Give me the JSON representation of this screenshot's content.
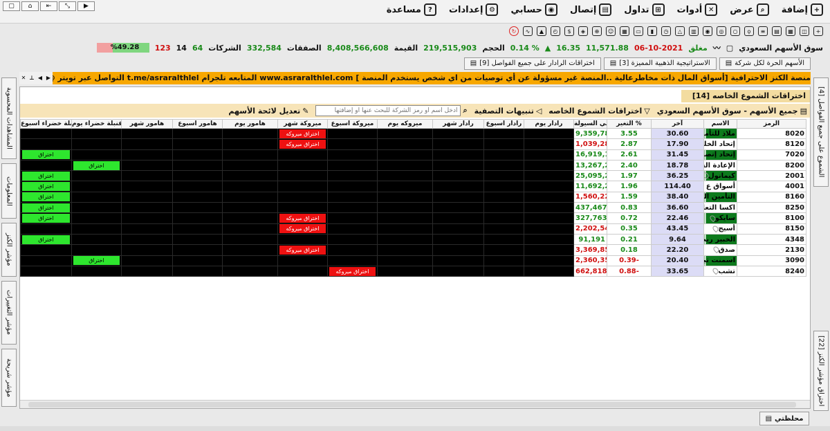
{
  "window": {
    "controls": [
      "▢",
      "⌂",
      "⇤",
      "⤡",
      "▶"
    ]
  },
  "menu": [
    {
      "label": "إضافة",
      "icon": "add-icon",
      "glyph": "+"
    },
    {
      "label": "عرض",
      "icon": "view-icon",
      "glyph": "⌕"
    },
    {
      "label": "أدوات",
      "icon": "tools-icon",
      "glyph": "✕"
    },
    {
      "label": "تداول",
      "icon": "cart-icon",
      "glyph": "⊞"
    },
    {
      "label": "إتصال",
      "icon": "connect-icon",
      "glyph": "▤"
    },
    {
      "label": "حسابي",
      "icon": "user-icon",
      "glyph": "◉"
    },
    {
      "label": "إعدادات",
      "icon": "gear-icon",
      "glyph": "⚙"
    },
    {
      "label": "مساعدة",
      "icon": "help-icon",
      "glyph": "?"
    }
  ],
  "summary": {
    "market": "سوق الأسهم السعودي",
    "status": "مغلق",
    "date": "06-10-2021",
    "index": "11,571.88",
    "change": "16.35",
    "change_pct": "0.14 %",
    "volume_label": "الحجم",
    "volume": "219,515,903",
    "value_label": "القيمة",
    "value": "8,408,566,608",
    "deals_label": "الصفقات",
    "deals": "332,584",
    "companies_label": "الشركات",
    "up": "64",
    "unchanged": "14",
    "down": "123",
    "breadth_pct": "%49.28"
  },
  "tabs": [
    "الأسهم الحرة لكل شركة",
    "الاستراتيجية الذهبية المميزة [3]",
    "اختراقات الرادار على جميع الفواصل [9]"
  ],
  "ticker": "منصة الكنز الاحترافية [أسواق المال ذات مخاطرعالية ..المنصة غير مسؤولة عن أي توصيات من اي شخص يستخدم المنصة ]   www.asraralthlel.com   المتابعه  تلجرام  t.me/asraralthlel التواصل عبر تويتر @aber_sabel3",
  "side_tabs_right": [
    "الشموع على جميع الفواصل [4]",
    "اختراق مؤشر الكنز [22]"
  ],
  "side_tabs_left": [
    "المشاهدات المحسوبة",
    "المعلومات",
    "مؤشر الكنز",
    "مؤشر التغييرات",
    "مؤشر شريحة"
  ],
  "panel": {
    "title": "اختراقات الشموع الخاصه [14]",
    "market_filter": "جميع الأسهم - سوق الأسهم السعودي",
    "filter_label": "اختراقات الشموع الخاصه",
    "alerts_label": "تنبيهات التصفية",
    "search_placeholder": "ادخل اسم أو رمز الشركة للبحث عنها أو إضافتها",
    "edit_list_label": "تعديل لائحة الأسهم"
  },
  "columns": [
    "الرمز",
    "الاسم",
    "آخر",
    "التغير %",
    "صافي السيولة",
    "رادار يوم",
    "رادار اسبوع",
    "رادار شهر",
    "ميروكه يوم",
    "ميروكة اسبوع",
    "ميروكة شهر",
    "هامور يوم",
    "هامور اسبوع",
    "هامور شهر",
    "قنبلة خضراء يوم",
    "قنبلة خضراء اسبوع"
  ],
  "signals": {
    "green": "اختراق",
    "red": "اختراق ميروكه"
  },
  "rows": [
    {
      "symbol": "8020",
      "name": "ملاذ للتأمين",
      "dark": true,
      "last": "30.60",
      "chg": "3.55",
      "chg_neg": false,
      "liq": "9,359,787",
      "liq_neg": false,
      "sig": {
        "5": "r"
      }
    },
    {
      "symbol": "8120",
      "name": "إتحاد الخليج الأهلية",
      "dark": false,
      "last": "17.90",
      "chg": "2.87",
      "chg_neg": false,
      "liq": "1,039,285-",
      "liq_neg": true,
      "sig": {
        "5": "r",
        "11": "g"
      }
    },
    {
      "symbol": "7020",
      "name": "إتحاد إتصالات",
      "dark": true,
      "last": "31.45",
      "chg": "2.61",
      "chg_neg": false,
      "liq": "16,919,159",
      "liq_neg": false,
      "sig": {
        "0": "g",
        "12": "g"
      }
    },
    {
      "symbol": "8200",
      "name": "الإعادة السعودية",
      "dark": false,
      "last": "18.78",
      "chg": "2.40",
      "chg_neg": false,
      "liq": "13,267,288",
      "liq_neg": false,
      "sig": {
        "1": "g",
        "11": "g"
      }
    },
    {
      "symbol": "2001",
      "name": "كيمانول",
      "dark": true,
      "last": "36.25",
      "chg": "1.97",
      "chg_neg": false,
      "liq": "25,095,260",
      "liq_neg": false,
      "sig": {
        "0": "g",
        "12": "g"
      }
    },
    {
      "symbol": "4001",
      "name": "أسواق ع العثيم",
      "dark": false,
      "last": "114.40",
      "chg": "1.96",
      "chg_neg": false,
      "liq": "11,692,289",
      "liq_neg": false,
      "sig": {
        "0": "g",
        "12": "g"
      }
    },
    {
      "symbol": "8160",
      "name": "التأمين العربية",
      "dark": true,
      "last": "38.40",
      "chg": "1.59",
      "chg_neg": false,
      "liq": "1,560,222-",
      "liq_neg": true,
      "sig": {
        "0": "g",
        "11": "g",
        "12": "g"
      }
    },
    {
      "symbol": "8250",
      "name": "اكسا التعاونية",
      "dark": false,
      "last": "36.60",
      "chg": "0.83",
      "chg_neg": false,
      "liq": "437,467",
      "liq_neg": false,
      "sig": {
        "0": "g",
        "11": "g",
        "12": "g"
      }
    },
    {
      "symbol": "8100",
      "name": "سايكو",
      "dark": true,
      "last": "22.46",
      "chg": "0.72",
      "chg_neg": false,
      "liq": "327,763",
      "liq_neg": false,
      "sig": {
        "0": "g",
        "5": "r",
        "12": "g"
      }
    },
    {
      "symbol": "8150",
      "name": "أسيج",
      "dark": false,
      "last": "43.45",
      "chg": "0.35",
      "chg_neg": false,
      "liq": "2,202,541-",
      "liq_neg": true,
      "sig": {
        "5": "r"
      }
    },
    {
      "symbol": "4348",
      "name": "الخبير ريت",
      "dark": true,
      "last": "9.64",
      "chg": "0.21",
      "chg_neg": false,
      "liq": "91,191",
      "liq_neg": false,
      "sig": {
        "0": "g",
        "12": "g"
      }
    },
    {
      "symbol": "2130",
      "name": "صدق",
      "dark": false,
      "last": "22.20",
      "chg": "0.18",
      "chg_neg": false,
      "liq": "3,369,858-",
      "liq_neg": true,
      "sig": {
        "5": "r"
      }
    },
    {
      "symbol": "3090",
      "name": "اسمنت تبوك",
      "dark": true,
      "last": "20.40",
      "chg": "0.39-",
      "chg_neg": true,
      "liq": "2,360,355-",
      "liq_neg": true,
      "sig": {
        "1": "g"
      }
    },
    {
      "symbol": "8240",
      "name": "تشب",
      "dark": false,
      "last": "33.65",
      "chg": "0.88-",
      "chg_neg": true,
      "liq": "662,818-",
      "liq_neg": true,
      "sig": {
        "6": "r"
      }
    }
  ],
  "bottom_tab": "محلظتي"
}
